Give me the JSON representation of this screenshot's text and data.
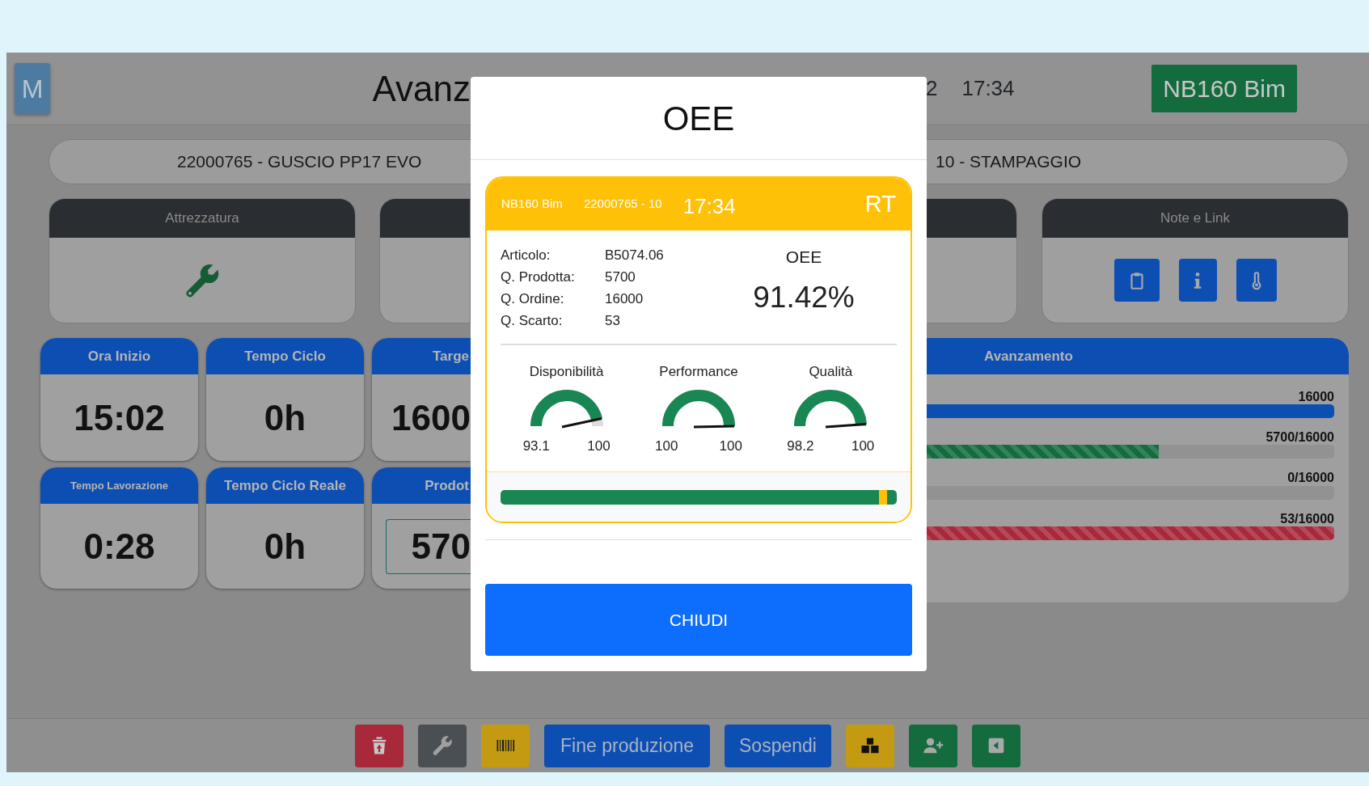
{
  "header": {
    "logo": "M",
    "title": "Avanz",
    "date": "2",
    "time": "17:34",
    "machine": "NB160 Bim"
  },
  "order": {
    "article": "22000765 - GUSCIO PP17 EVO",
    "phase": "10 - STAMPAGGIO"
  },
  "panels_left": [
    {
      "kind": "tool",
      "title": "Attrezzatura"
    },
    {
      "kind": "cut"
    }
  ],
  "panels_right": [
    {
      "kind": "cut"
    },
    {
      "kind": "links",
      "title": "Note e Link"
    }
  ],
  "tile_rows": [
    [
      {
        "kind": "full",
        "label": "Ora Inizio",
        "value": "15:02"
      },
      {
        "kind": "full",
        "label": "Tempo Ciclo",
        "value": "0h"
      },
      {
        "kind": "cut",
        "label": "Targe",
        "value": "1600"
      }
    ],
    [
      {
        "kind": "full",
        "small": true,
        "label": "Tempo Lavorazione",
        "value": "0:28"
      },
      {
        "kind": "full",
        "label": "Tempo Ciclo Reale",
        "value": "0h"
      },
      {
        "kind": "cut-input",
        "label": "Prodot",
        "value": "570"
      }
    ]
  ],
  "progress": {
    "title": "Avanzamento",
    "bars": [
      {
        "reading": "16000",
        "level": 1,
        "color": "#0d4eb3",
        "striped": false
      },
      {
        "reading": "5700/16000",
        "level": 0.57,
        "color": "#136b3e",
        "striped": true
      },
      {
        "reading": "0/16000"
      },
      {
        "reading": "53/16000",
        "level": 1,
        "color": "#a8293a",
        "striped": true
      }
    ]
  },
  "toolbar": [
    {
      "kind": "icon",
      "color": "#a8293a"
    },
    {
      "kind": "icon",
      "color": "#4a4f54"
    },
    {
      "kind": "icon",
      "color": "#c49a12"
    },
    {
      "kind": "text",
      "label": "Fine produzione",
      "color": "#0d4eb3"
    },
    {
      "kind": "text",
      "label": "Sospendi",
      "color": "#0d4eb3"
    },
    {
      "kind": "icon",
      "color": "#c49a12"
    },
    {
      "kind": "icon",
      "color": "#136b3e"
    },
    {
      "kind": "icon",
      "color": "#136b3e"
    }
  ],
  "modal": {
    "title": "OEE",
    "card": {
      "machine": "NB160 Bim",
      "order": "22000765 - 10",
      "time": "17:34",
      "mode": "RT",
      "details": [
        {
          "label": "Articolo:",
          "value": "B5074.06"
        },
        {
          "label": "Q. Prodotta:",
          "value": "5700"
        },
        {
          "label": "Q. Ordine:",
          "value": "16000"
        },
        {
          "label": "Q. Scarto:",
          "value": "53"
        }
      ],
      "oee_label": "OEE",
      "oee_value": "91.42%",
      "gauges": [
        {
          "name": "Disponibilità",
          "reading": "93.1",
          "max": "100"
        },
        {
          "name": "Performance",
          "reading": "100",
          "max": "100"
        },
        {
          "name": "Qualità",
          "reading": "98.2",
          "max": "100"
        }
      ]
    },
    "button": "CHIUDI"
  }
}
